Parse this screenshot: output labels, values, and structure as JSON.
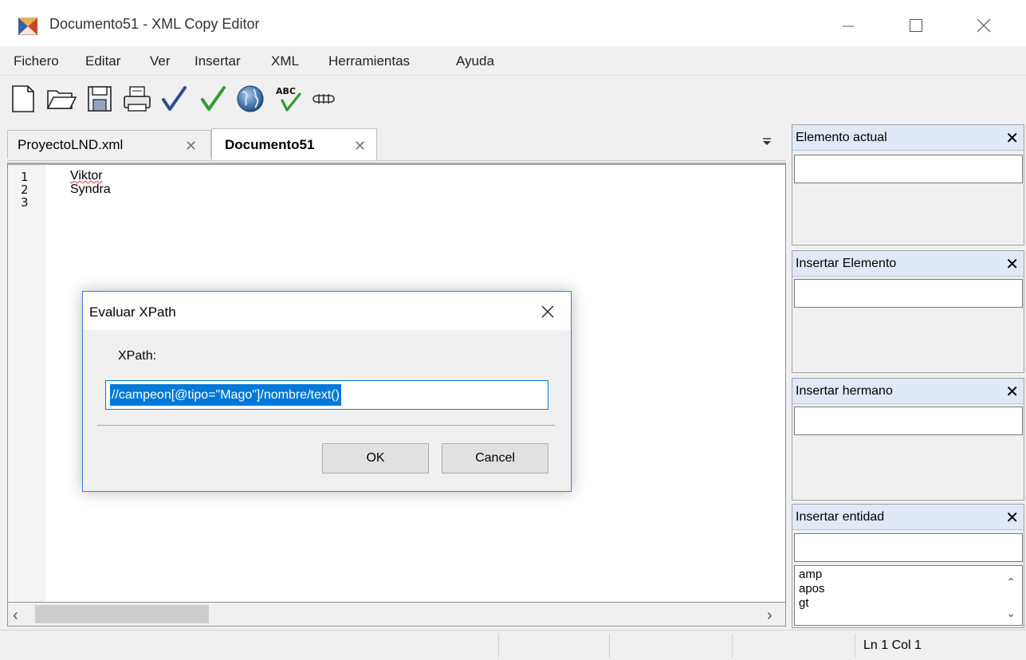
{
  "window": {
    "title": "Documento51 - XML Copy Editor"
  },
  "menu": [
    "Fichero",
    "Editar",
    "Ver",
    "Insertar",
    "XML",
    "Herramientas",
    "Ayuda"
  ],
  "toolbar": {
    "icons": [
      "new-document-icon",
      "open-folder-icon",
      "save-icon",
      "print-icon",
      "check-wellformed-icon",
      "validate-icon",
      "browser-globe-icon",
      "spellcheck-icon",
      "xslt-transform-icon"
    ],
    "spell_label": "ABC"
  },
  "tabs": [
    {
      "label": "ProyectoLND.xml",
      "active": false
    },
    {
      "label": "Documento51",
      "active": true
    }
  ],
  "editor": {
    "lines": [
      {
        "number": "1",
        "text": "Viktor"
      },
      {
        "number": "2",
        "text": "Syndra"
      },
      {
        "number": "3",
        "text": ""
      }
    ]
  },
  "panels": [
    {
      "title": "Elemento actual"
    },
    {
      "title": "Insertar Elemento"
    },
    {
      "title": "Insertar hermano"
    },
    {
      "title": "Insertar entidad",
      "items": [
        "amp",
        "apos",
        "gt"
      ]
    }
  ],
  "status": {
    "position": "Ln 1 Col 1"
  },
  "dialog": {
    "title": "Evaluar XPath",
    "label": "XPath:",
    "value": "//campeon[@tipo=\"Mago\"]/nombre/text()",
    "ok_label": "OK",
    "cancel_label": "Cancel"
  },
  "colors": {
    "accent": "#0078d7",
    "panel_header": "#e0e9f5",
    "check_green": "#2e9e2e",
    "check_blue": "#2d4f8e"
  }
}
